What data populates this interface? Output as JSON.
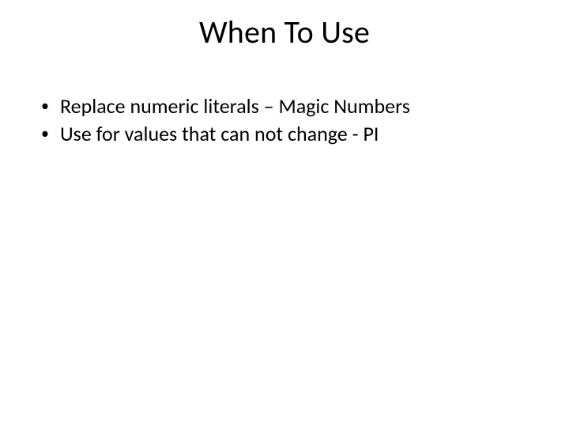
{
  "slide": {
    "title": "When To Use",
    "bullets": [
      "Replace numeric literals – Magic Numbers",
      "Use for values that can not change - PI"
    ]
  }
}
